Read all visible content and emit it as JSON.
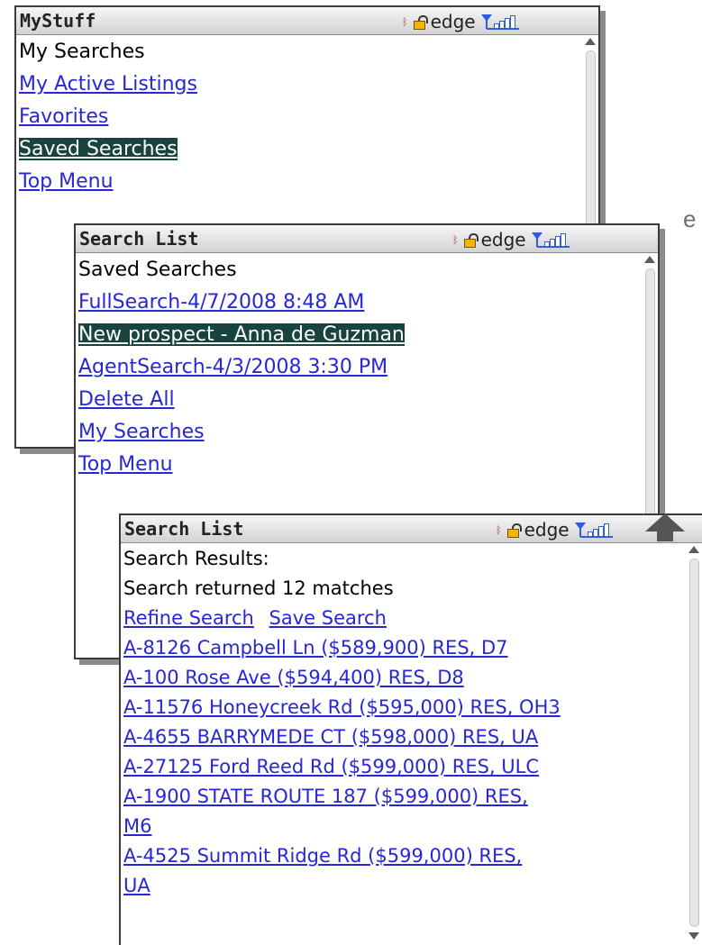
{
  "bg_letters": [
    "e",
    "e"
  ],
  "screen1": {
    "title": "MyStuff",
    "status": {
      "network": "edge"
    },
    "lines": [
      {
        "text": "My Searches",
        "style": "plain"
      },
      {
        "text": "My Active Listings",
        "style": "link"
      },
      {
        "text": "Favorites",
        "style": "link"
      },
      {
        "text": "Saved Searches",
        "style": "selected"
      },
      {
        "text": "Top Menu",
        "style": "link"
      }
    ]
  },
  "screen2": {
    "title": "Search List",
    "status": {
      "network": "edge"
    },
    "lines": [
      {
        "text": "Saved Searches",
        "style": "plain"
      },
      {
        "text": "FullSearch-4/7/2008 8:48 AM",
        "style": "link"
      },
      {
        "text": "New prospect - Anna de Guzman",
        "style": "selected"
      },
      {
        "text": "AgentSearch-4/3/2008 3:30 PM",
        "style": "link"
      },
      {
        "text": "Delete All",
        "style": "link"
      },
      {
        "text": "My Searches",
        "style": "link"
      },
      {
        "text": "Top Menu",
        "style": "link"
      }
    ]
  },
  "screen3": {
    "title": "Search List",
    "status": {
      "network": "edge"
    },
    "header": "Search Results:",
    "summary": "Search returned 12 matches",
    "actions": {
      "refine": "Refine Search",
      "save": "Save Search"
    },
    "results": [
      "A-8126 Campbell Ln ($589,900) RES, D7",
      "A-100 Rose Ave ($594,400) RES, D8",
      "A-11576 Honeycreek Rd ($595,000) RES, OH3",
      "A-4655 BARRYMEDE CT ($598,000) RES, UA",
      "A-27125 Ford Reed Rd ($599,000) RES, ULC",
      "A-1900 STATE ROUTE 187 ($599,000) RES,",
      "M6",
      "A-4525 Summit Ridge Rd ($599,000) RES,",
      "UA"
    ]
  },
  "colors": {
    "link": "#2727d6",
    "selected_bg": "#18433f",
    "signal": "#2f5de0",
    "lock": "#f3b600"
  },
  "icons": [
    "bluetooth-icon",
    "lock-icon",
    "signal-strength-icon",
    "scroll-up-icon",
    "scroll-down-icon",
    "up-arrow-icon"
  ]
}
